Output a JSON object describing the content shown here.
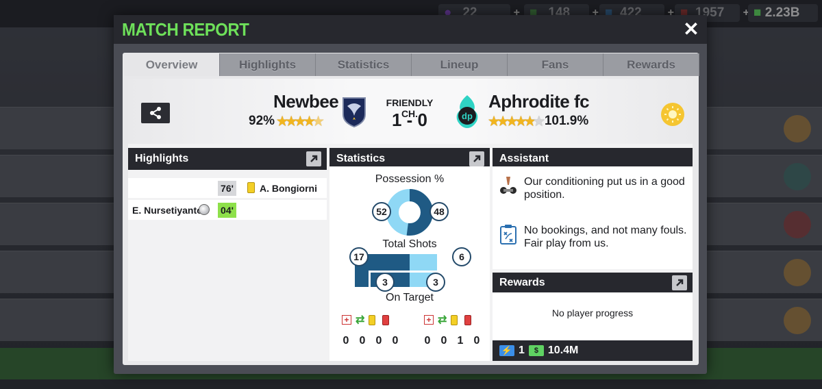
{
  "background": {
    "currencies": [
      {
        "name": "currency-coins",
        "value": "22"
      },
      {
        "name": "currency-tokens",
        "value": "148"
      },
      {
        "name": "currency-energy",
        "value": "422"
      },
      {
        "name": "currency-medical",
        "value": "1957"
      },
      {
        "name": "currency-cash",
        "value": "2.23B"
      }
    ]
  },
  "modal": {
    "title": "MATCH REPORT",
    "close_label": "✕"
  },
  "tabs": [
    {
      "label": "Overview",
      "active": true
    },
    {
      "label": "Highlights",
      "active": false
    },
    {
      "label": "Statistics",
      "active": false
    },
    {
      "label": "Lineup",
      "active": false
    },
    {
      "label": "Fans",
      "active": false
    },
    {
      "label": "Rewards",
      "active": false
    }
  ],
  "match": {
    "home_team": "Newbee",
    "home_rating": "92%",
    "home_stars": 4.5,
    "away_team": "Aphrodite fc",
    "away_rating": "101.9%",
    "away_stars": 4.5,
    "competition": "FRIENDLY CH.",
    "score": "1 - 0"
  },
  "highlights": {
    "title": "Highlights",
    "events": [
      {
        "minute": "76'",
        "player": "A. Bongiorni",
        "side": "away",
        "type": "yellow-card"
      },
      {
        "minute": "04'",
        "player": "E. Nursetiyanto",
        "side": "home",
        "type": "goal"
      }
    ]
  },
  "statistics": {
    "title": "Statistics",
    "possession_label": "Possession %",
    "possession_home": 52,
    "possession_away": 48,
    "shots_label": "Total Shots",
    "shots_home": 17,
    "shots_away": 6,
    "on_target_label": "On Target",
    "on_target_home": 3,
    "on_target_away": 3,
    "home_events": [
      "0",
      "0",
      "0",
      "0"
    ],
    "away_events": [
      "0",
      "0",
      "1",
      "0"
    ],
    "colors": {
      "home": "#1f5a84",
      "away": "#8fd8f5"
    }
  },
  "assistant": {
    "title": "Assistant",
    "messages": [
      {
        "icon": "fitness-icon",
        "text": "Our conditioning put us in a good position."
      },
      {
        "icon": "tactics-board-icon",
        "text": "No bookings, and not many fouls. Fair play from us."
      }
    ]
  },
  "rewards": {
    "title": "Rewards",
    "message": "No player progress",
    "energy": "1",
    "cash": "10.4M"
  }
}
